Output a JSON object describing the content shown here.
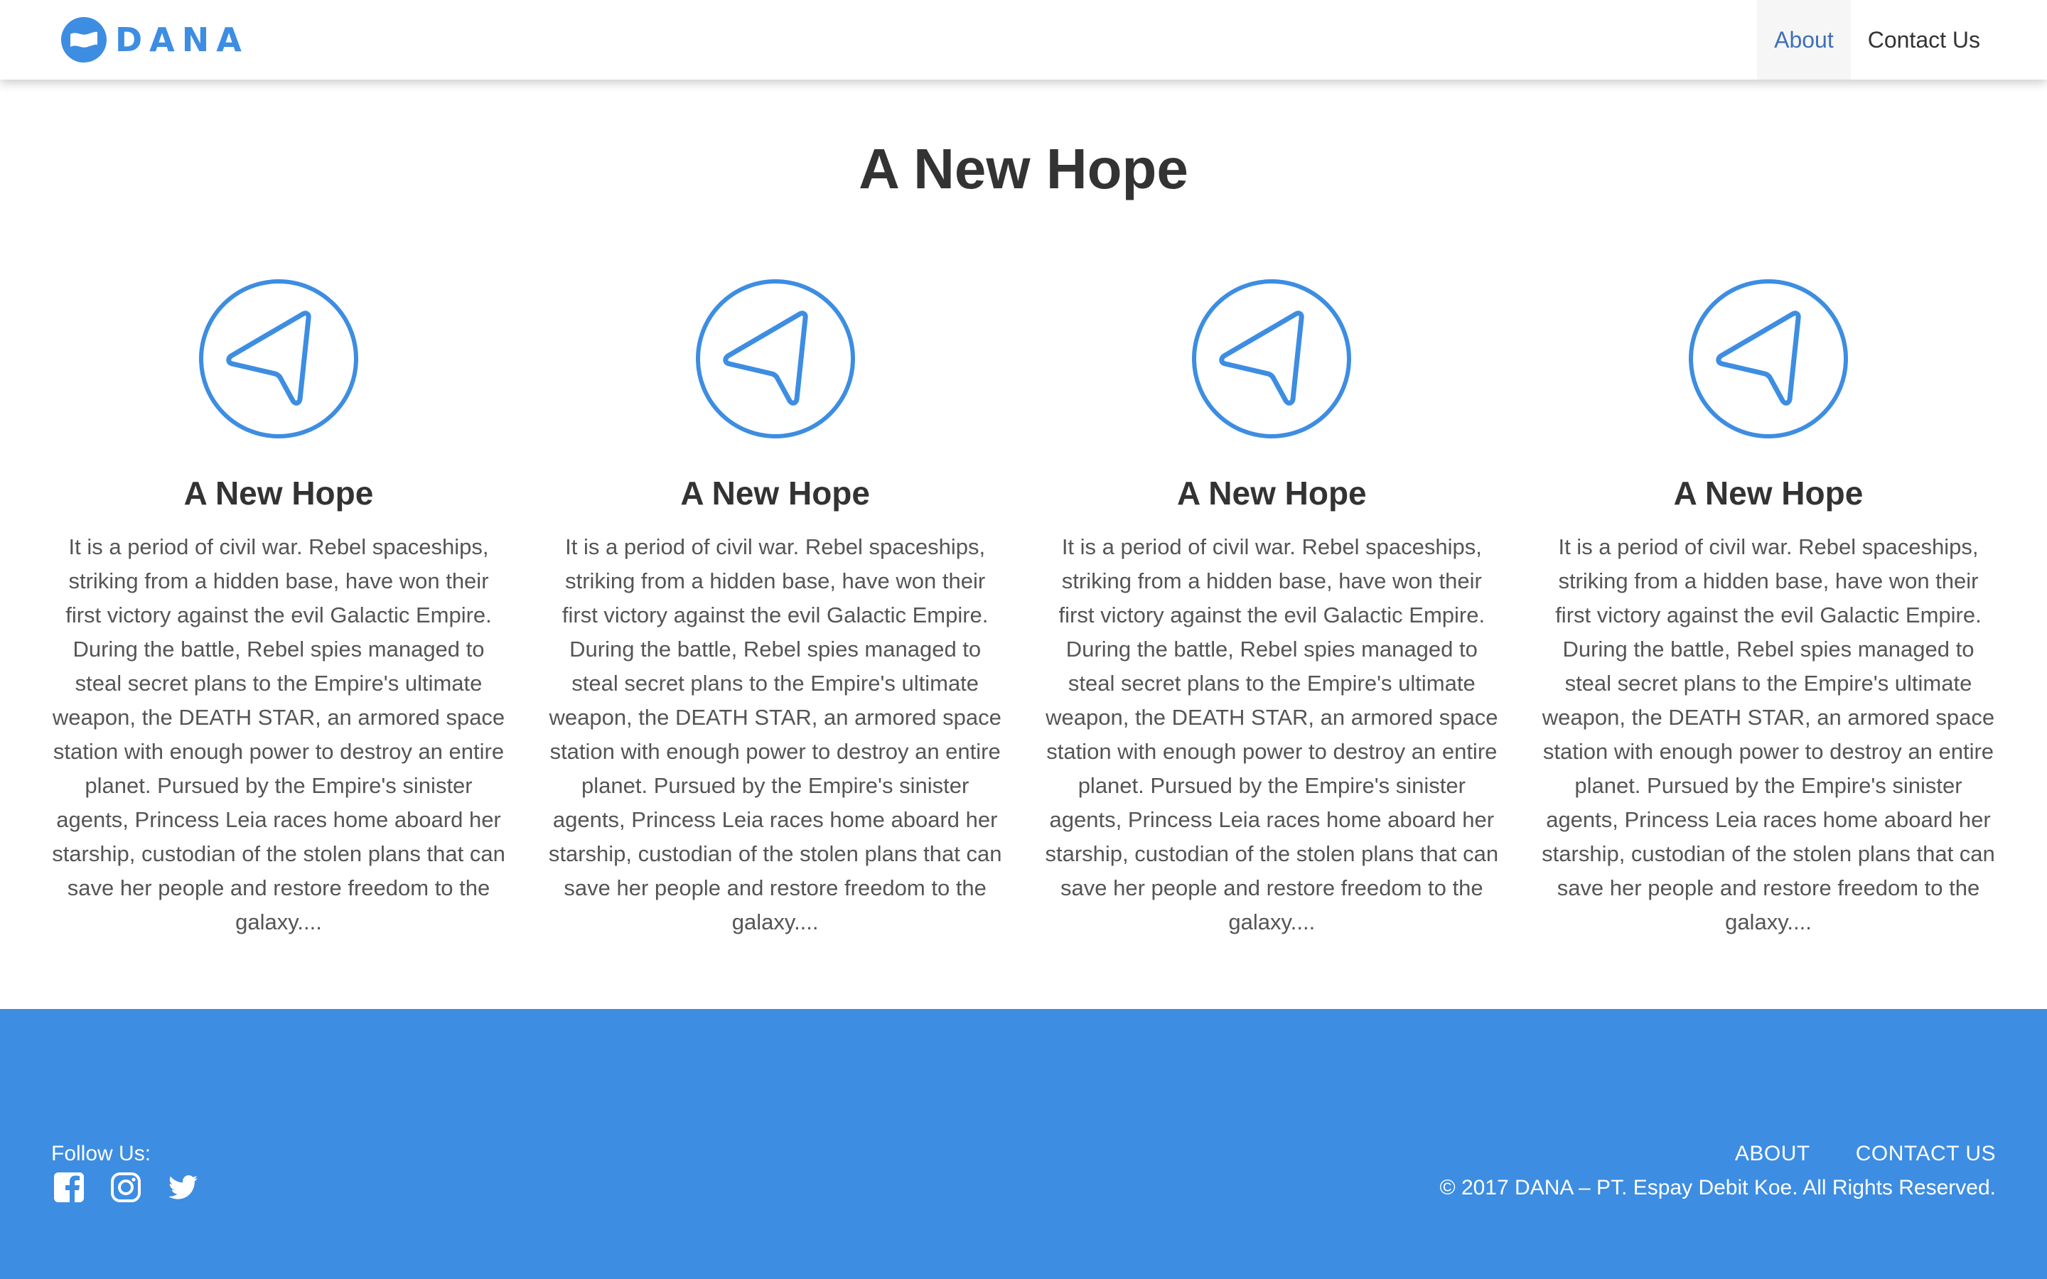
{
  "header": {
    "brand": "DANA",
    "nav": [
      {
        "label": "About",
        "active": true
      },
      {
        "label": "Contact Us",
        "active": false
      }
    ]
  },
  "main": {
    "title": "A New Hope",
    "features": [
      {
        "icon": "navigation-arrow-icon",
        "title": "A New Hope",
        "text": "It is a period of civil war. Rebel spaceships, striking from a hidden base, have won their first victory against the evil Galactic Empire. During the battle, Rebel spies managed to steal secret plans to the Empire's ultimate weapon, the DEATH STAR, an armored space station with enough power to destroy an entire planet. Pursued by the Empire's sinister agents, Princess Leia races home aboard her starship, custodian of the stolen plans that can save her people and restore freedom to the galaxy...."
      },
      {
        "icon": "navigation-arrow-icon",
        "title": "A New Hope",
        "text": "It is a period of civil war. Rebel spaceships, striking from a hidden base, have won their first victory against the evil Galactic Empire. During the battle, Rebel spies managed to steal secret plans to the Empire's ultimate weapon, the DEATH STAR, an armored space station with enough power to destroy an entire planet. Pursued by the Empire's sinister agents, Princess Leia races home aboard her starship, custodian of the stolen plans that can save her people and restore freedom to the galaxy...."
      },
      {
        "icon": "navigation-arrow-icon",
        "title": "A New Hope",
        "text": "It is a period of civil war. Rebel spaceships, striking from a hidden base, have won their first victory against the evil Galactic Empire. During the battle, Rebel spies managed to steal secret plans to the Empire's ultimate weapon, the DEATH STAR, an armored space station with enough power to destroy an entire planet. Pursued by the Empire's sinister agents, Princess Leia races home aboard her starship, custodian of the stolen plans that can save her people and restore freedom to the galaxy...."
      },
      {
        "icon": "navigation-arrow-icon",
        "title": "A New Hope",
        "text": "It is a period of civil war. Rebel spaceships, striking from a hidden base, have won their first victory against the evil Galactic Empire. During the battle, Rebel spies managed to steal secret plans to the Empire's ultimate weapon, the DEATH STAR, an armored space station with enough power to destroy an entire planet. Pursued by the Empire's sinister agents, Princess Leia races home aboard her starship, custodian of the stolen plans that can save her people and restore freedom to the galaxy...."
      }
    ]
  },
  "footer": {
    "follow_label": "Follow Us:",
    "social": [
      "facebook-icon",
      "instagram-icon",
      "twitter-icon"
    ],
    "nav": [
      {
        "label": "ABOUT"
      },
      {
        "label": "CONTACT US"
      }
    ],
    "copyright": "© 2017 DANA – PT. Espay Debit Koe. All Rights Reserved."
  },
  "colors": {
    "brand_blue": "#3d8de2",
    "nav_active": "#3f6fb9",
    "text_dark": "#333333",
    "text_body": "#555555"
  }
}
